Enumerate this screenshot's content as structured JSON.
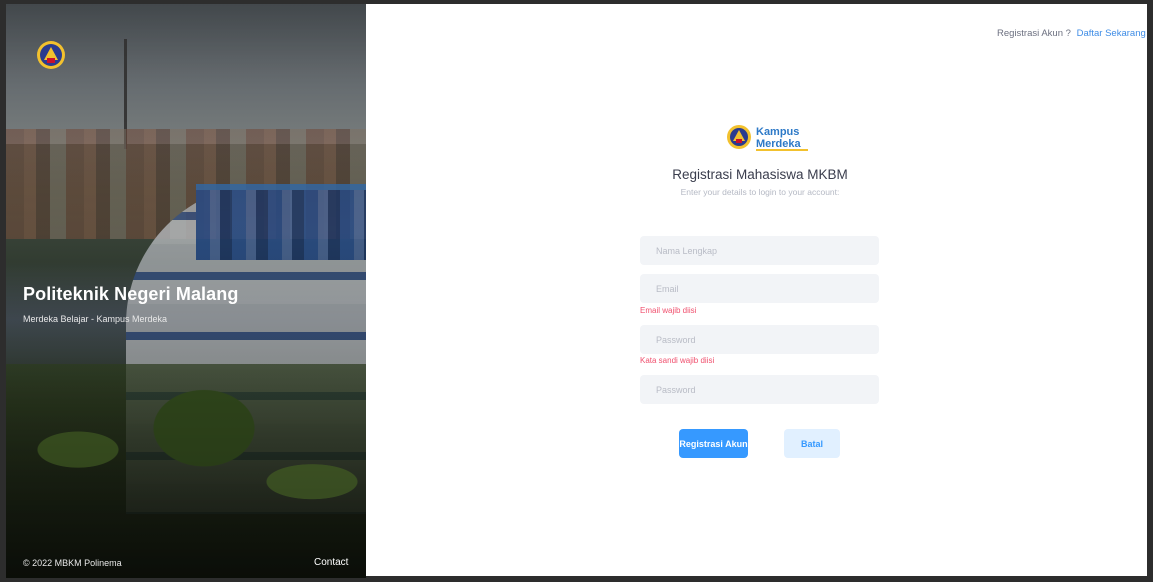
{
  "hero": {
    "title": "Politeknik Negeri Malang",
    "subtitle": "Merdeka Belajar - Kampus Merdeka",
    "copyright": "© 2022 MBKM Polinema",
    "contact_label": "Contact",
    "logo_icon": "polinema-crest-icon"
  },
  "topnav": {
    "question": "Registrasi Akun ?",
    "link_label": "Daftar Sekarang"
  },
  "brand": {
    "icon": "kampus-merdeka-logo",
    "text_top": "Kampus",
    "text_bottom": "Merdeka"
  },
  "form": {
    "title": "Registrasi Mahasiswa MKBM",
    "subtitle": "Enter your details to login to your account:",
    "name_placeholder": "Nama Lengkap",
    "email_placeholder": "Email",
    "email_error": "Email wajib diisi",
    "password_placeholder": "Password",
    "password_error": "Kata sandi wajib diisi",
    "password_confirm_placeholder": "Password",
    "submit_label": "Registrasi Akun",
    "cancel_label": "Batal"
  },
  "colors": {
    "primary": "#3699ff",
    "primary_light": "#e1f0ff",
    "error": "#f0506e",
    "link": "#3f8de6",
    "input_bg": "#f2f4f7"
  }
}
